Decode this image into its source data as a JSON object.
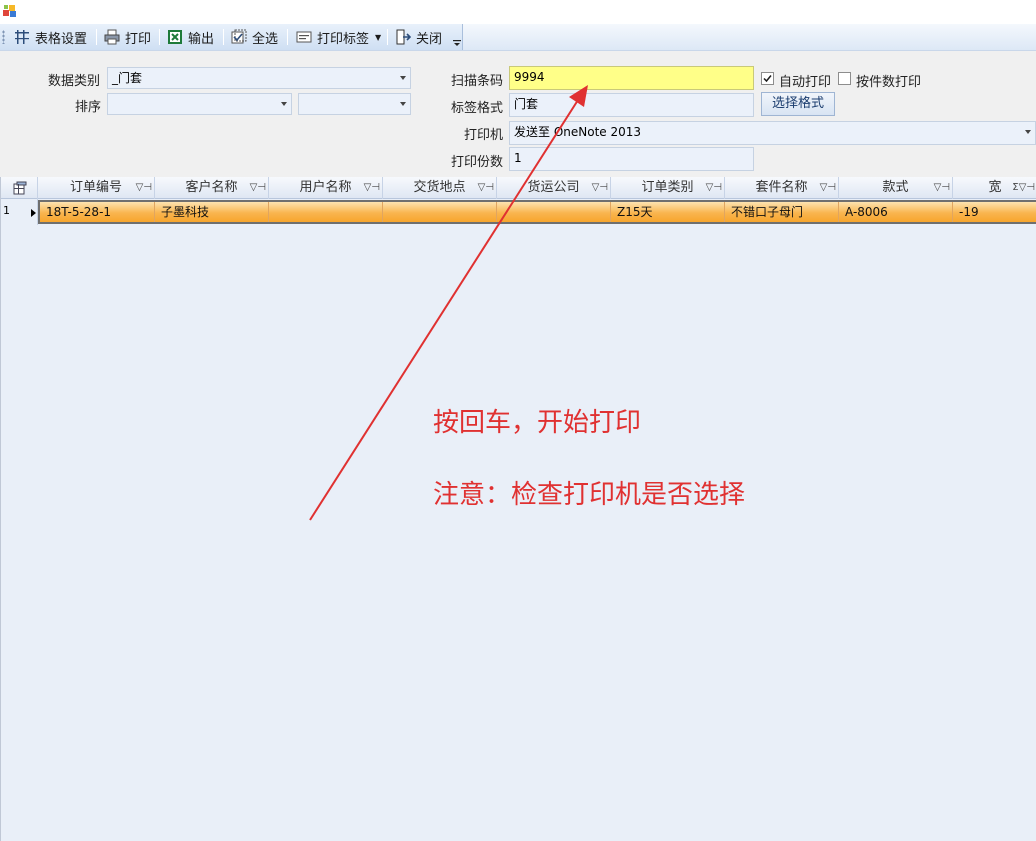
{
  "toolbar": {
    "items": [
      {
        "label": "表格设置",
        "icon": "table-settings-icon"
      },
      {
        "label": "打印",
        "icon": "printer-icon"
      },
      {
        "label": "输出",
        "icon": "excel-icon"
      },
      {
        "label": "全选",
        "icon": "select-all-icon"
      },
      {
        "label": "打印标签",
        "icon": "print-label-icon"
      },
      {
        "label": "关闭",
        "icon": "exit-icon"
      }
    ]
  },
  "filters": {
    "data_category_label": "数据类别",
    "data_category_value": "_门套",
    "sort_label": "排序",
    "sort_value_1": "",
    "sort_value_2": "",
    "scan_barcode_label": "扫描条码",
    "scan_barcode_value": "9994",
    "label_format_label": "标签格式",
    "label_format_value": "门套",
    "choose_format_button": "选择格式",
    "printer_label": "打印机",
    "printer_value": "发送至 OneNote 2013",
    "copies_label": "打印份数",
    "copies_value": "1",
    "auto_print_label": "自动打印",
    "auto_print_checked": true,
    "print_by_count_label": "按件数打印",
    "print_by_count_checked": false
  },
  "grid": {
    "columns": [
      "订单编号",
      "客户名称",
      "用户名称",
      "交货地点",
      "货运公司",
      "订单类别",
      "套件名称",
      "款式",
      "宽"
    ],
    "rows": [
      {
        "row_number": "1",
        "cells": [
          "18T-5-28-1",
          "子墨科技",
          "",
          "",
          "",
          "Z15天",
          "不错口子母门",
          "A-8006",
          "-19"
        ]
      }
    ]
  },
  "annotations": {
    "line1": "按回车，开始打印",
    "line2": "注意：检查打印机是否选择",
    "color": "#e03131"
  },
  "colors": {
    "selected_row": "#f9b54f",
    "barcode_field": "#ffff88",
    "grid_background": "#e9eff8"
  }
}
